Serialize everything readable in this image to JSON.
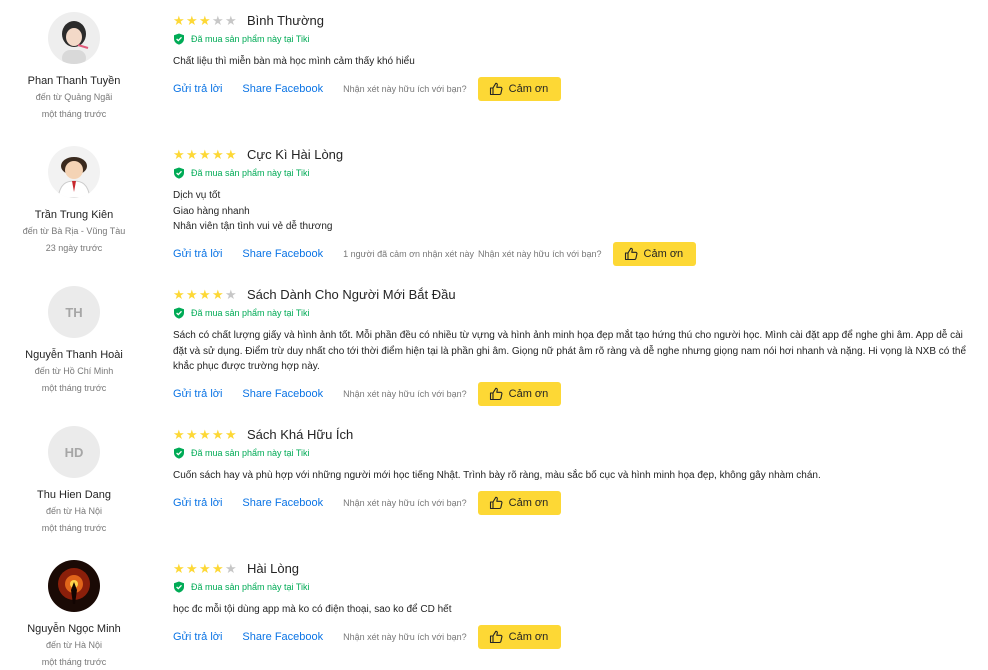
{
  "colors": {
    "star": "#fdd836",
    "verified": "#00ab56",
    "link": "#0b74e5",
    "button": "#fdd835"
  },
  "common": {
    "verified_label": "Đã mua sản phẩm này tại Tiki",
    "reply_label": "Gửi trả lời",
    "share_label": "Share Facebook",
    "helpful_question": "Nhận xét này hữu ích với bạn?",
    "thanks_label": "Cảm ơn"
  },
  "reviews": [
    {
      "user": {
        "name": "Phan Thanh Tuyền",
        "from": "đến từ Quảng Ngãi",
        "ago": "một tháng trước",
        "avatar": "photo-portrait"
      },
      "rating": 3,
      "title": "Bình Thường",
      "body": "Chất liệu thì miễn bàn mà học mình cảm thấy khó hiểu",
      "thanks_count": ""
    },
    {
      "user": {
        "name": "Trần Trung Kiên",
        "from": "đến từ Bà Rịa - Vũng Tàu",
        "ago": "23 ngày trước",
        "avatar": "photo-cartoon"
      },
      "rating": 5,
      "title": "Cực Kì Hài Lòng",
      "body": "Dịch vụ tốt\nGiao hàng nhanh\nNhân viên tận tình vui vẻ dễ thương",
      "thanks_count": "1 người đã cảm ơn nhận xét này"
    },
    {
      "user": {
        "name": "Nguyễn Thanh Hoài",
        "from": "đến từ Hồ Chí Minh",
        "ago": "một tháng trước",
        "initials": "TH"
      },
      "rating": 4,
      "title": "Sách Dành Cho Người Mới Bắt Đầu",
      "body": "Sách có chất lượng giấy và hình ảnh tốt. Mỗi phần đều có nhiều từ vựng và hình ảnh minh họa đẹp mắt tạo hứng thú cho người học. Mình cài đặt app để nghe ghi âm. App dễ cài đặt và sử dụng. Điểm trừ duy nhất cho tới thời điểm hiện tại là phần ghi âm. Giọng nữ phát âm rõ ràng và dễ nghe nhưng giọng nam nói hơi nhanh và nặng. Hi vọng là NXB có thể khắc phục được trường hợp này.",
      "thanks_count": ""
    },
    {
      "user": {
        "name": "Thu Hien Dang",
        "from": "đến từ Hà Nội",
        "ago": "một tháng trước",
        "initials": "HD"
      },
      "rating": 5,
      "title": "Sách Khá Hữu Ích",
      "body": "Cuốn sách hay và phù hợp với những người mới học tiếng Nhật. Trình bày rõ ràng, màu sắc bố cục và hình minh họa đẹp, không gây nhàm chán.",
      "thanks_count": ""
    },
    {
      "user": {
        "name": "Nguyễn Ngọc Minh",
        "from": "đến từ Hà Nội",
        "ago": "một tháng trước",
        "avatar": "photo-fire"
      },
      "rating": 4,
      "title": "Hài Lòng",
      "body": "học đc mỗi tội dùng app mà ko có điện thoại, sao ko để CD hết",
      "thanks_count": ""
    }
  ]
}
